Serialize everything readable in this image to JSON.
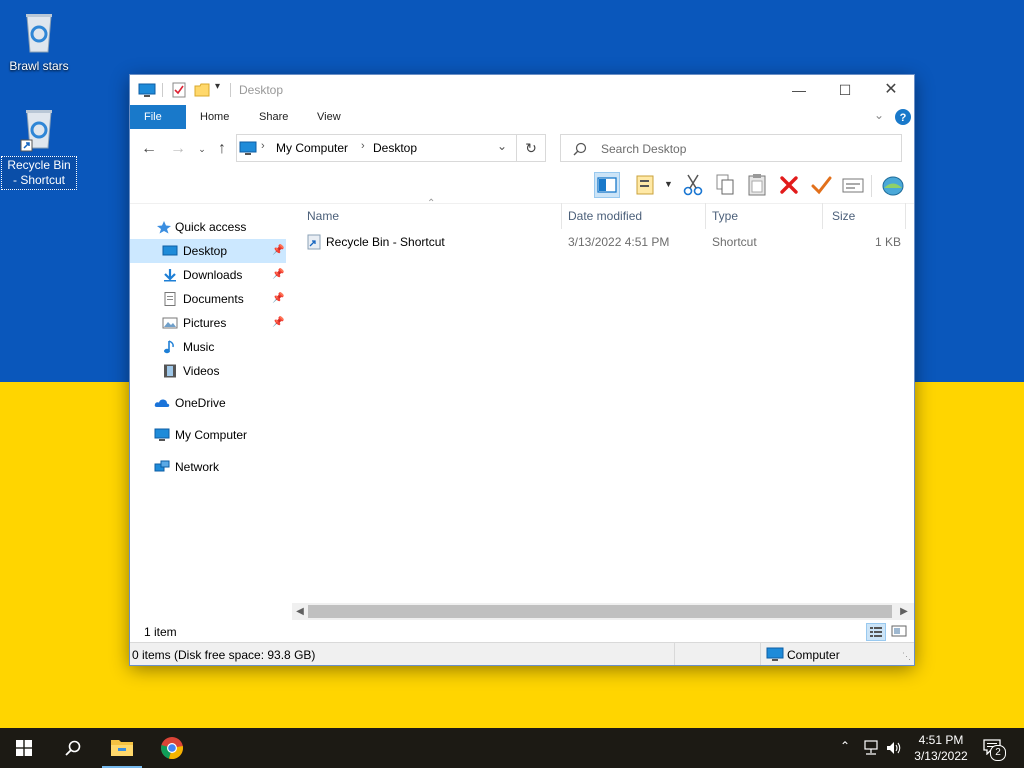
{
  "desktop": {
    "icons": [
      {
        "label": "Brawl stars"
      },
      {
        "label": "Recycle Bin - Shortcut"
      }
    ]
  },
  "window": {
    "title": "Desktop",
    "tabs": {
      "file": "File",
      "home": "Home",
      "share": "Share",
      "view": "View"
    },
    "address": {
      "root": "My Computer",
      "current": "Desktop"
    },
    "search_placeholder": "Search Desktop",
    "nav": {
      "quick_access": "Quick access",
      "desktop": "Desktop",
      "downloads": "Downloads",
      "documents": "Documents",
      "pictures": "Pictures",
      "music": "Music",
      "videos": "Videos",
      "onedrive": "OneDrive",
      "my_computer": "My Computer",
      "network": "Network"
    },
    "columns": {
      "name": "Name",
      "date": "Date modified",
      "type": "Type",
      "size": "Size"
    },
    "files": [
      {
        "name": "Recycle Bin - Shortcut",
        "date": "3/13/2022 4:51 PM",
        "type": "Shortcut",
        "size": "1 KB"
      }
    ],
    "item_count": "1 item",
    "status_left": "0 items (Disk free space: 93.8 GB)",
    "status_right": "Computer"
  },
  "taskbar": {
    "time": "4:51 PM",
    "date": "3/13/2022",
    "notifications": "2"
  },
  "colors": {
    "flag_blue": "#0a57bb",
    "flag_yellow": "#ffd500",
    "accent": "#1979ca",
    "selection": "#cce8ff"
  }
}
